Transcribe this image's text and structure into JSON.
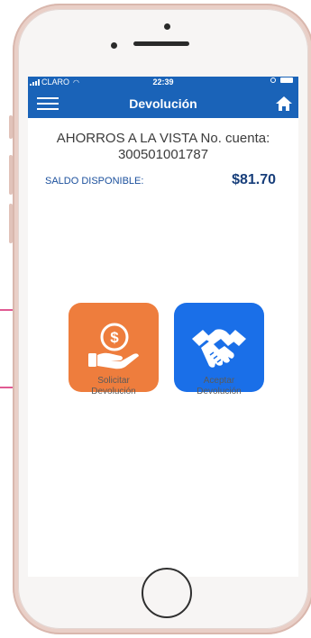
{
  "status_bar": {
    "carrier": "CLARO",
    "time": "22:39"
  },
  "nav": {
    "title": "Devolución",
    "menu_icon": "hamburger-icon",
    "home_icon": "home-icon"
  },
  "account": {
    "title_line1": "AHORROS A LA VISTA No. cuenta:",
    "title_line2": "300501001787",
    "balance_label": "SALDO DISPONIBLE:",
    "balance_value": "$81.70"
  },
  "actions": [
    {
      "label_line1": "Solicitar",
      "label_line2": "Devolución",
      "icon": "money-hand-icon",
      "color": "#ee7d3d"
    },
    {
      "label_line1": "Aceptar",
      "label_line2": "Devolución",
      "icon": "handshake-icon",
      "color": "#1a6fe8"
    }
  ],
  "colors": {
    "primary": "#1a63b8",
    "balance": "#173e7a",
    "annotation": "#d6246e"
  }
}
